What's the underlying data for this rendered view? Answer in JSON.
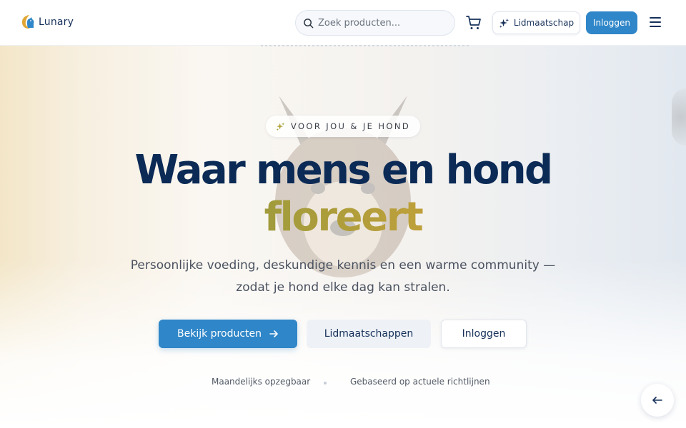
{
  "header": {
    "logo_text": "Lunary",
    "search_placeholder": "Zoek producten...",
    "membership_label": "Lidmaatschap",
    "login_label": "Inloggen",
    "icons": {
      "search": "search-icon",
      "cart": "cart-icon",
      "membership": "sparkles-icon",
      "menu": "hamburger-menu-icon"
    }
  },
  "hero": {
    "badge": "VOOR JOU & JE HOND",
    "title_line1": "Waar mens en hond",
    "title_line2": "floreert",
    "subtitle_line1": "Persoonlijke voeding, deskundige kennis en een warme community —",
    "subtitle_line2": "zodat je hond elke dag kan stralen.",
    "cta_primary": "Bekijk producten",
    "cta_secondary": "Lidmaatschappen",
    "cta_tertiary": "Inloggen",
    "features": [
      "Maandelijks opzegbaar",
      "Gebaseerd op actuele richtlijnen"
    ]
  },
  "colors": {
    "brand_blue": "#2f86c8",
    "navy": "#0b2a55",
    "gold": "#c9a23a"
  }
}
